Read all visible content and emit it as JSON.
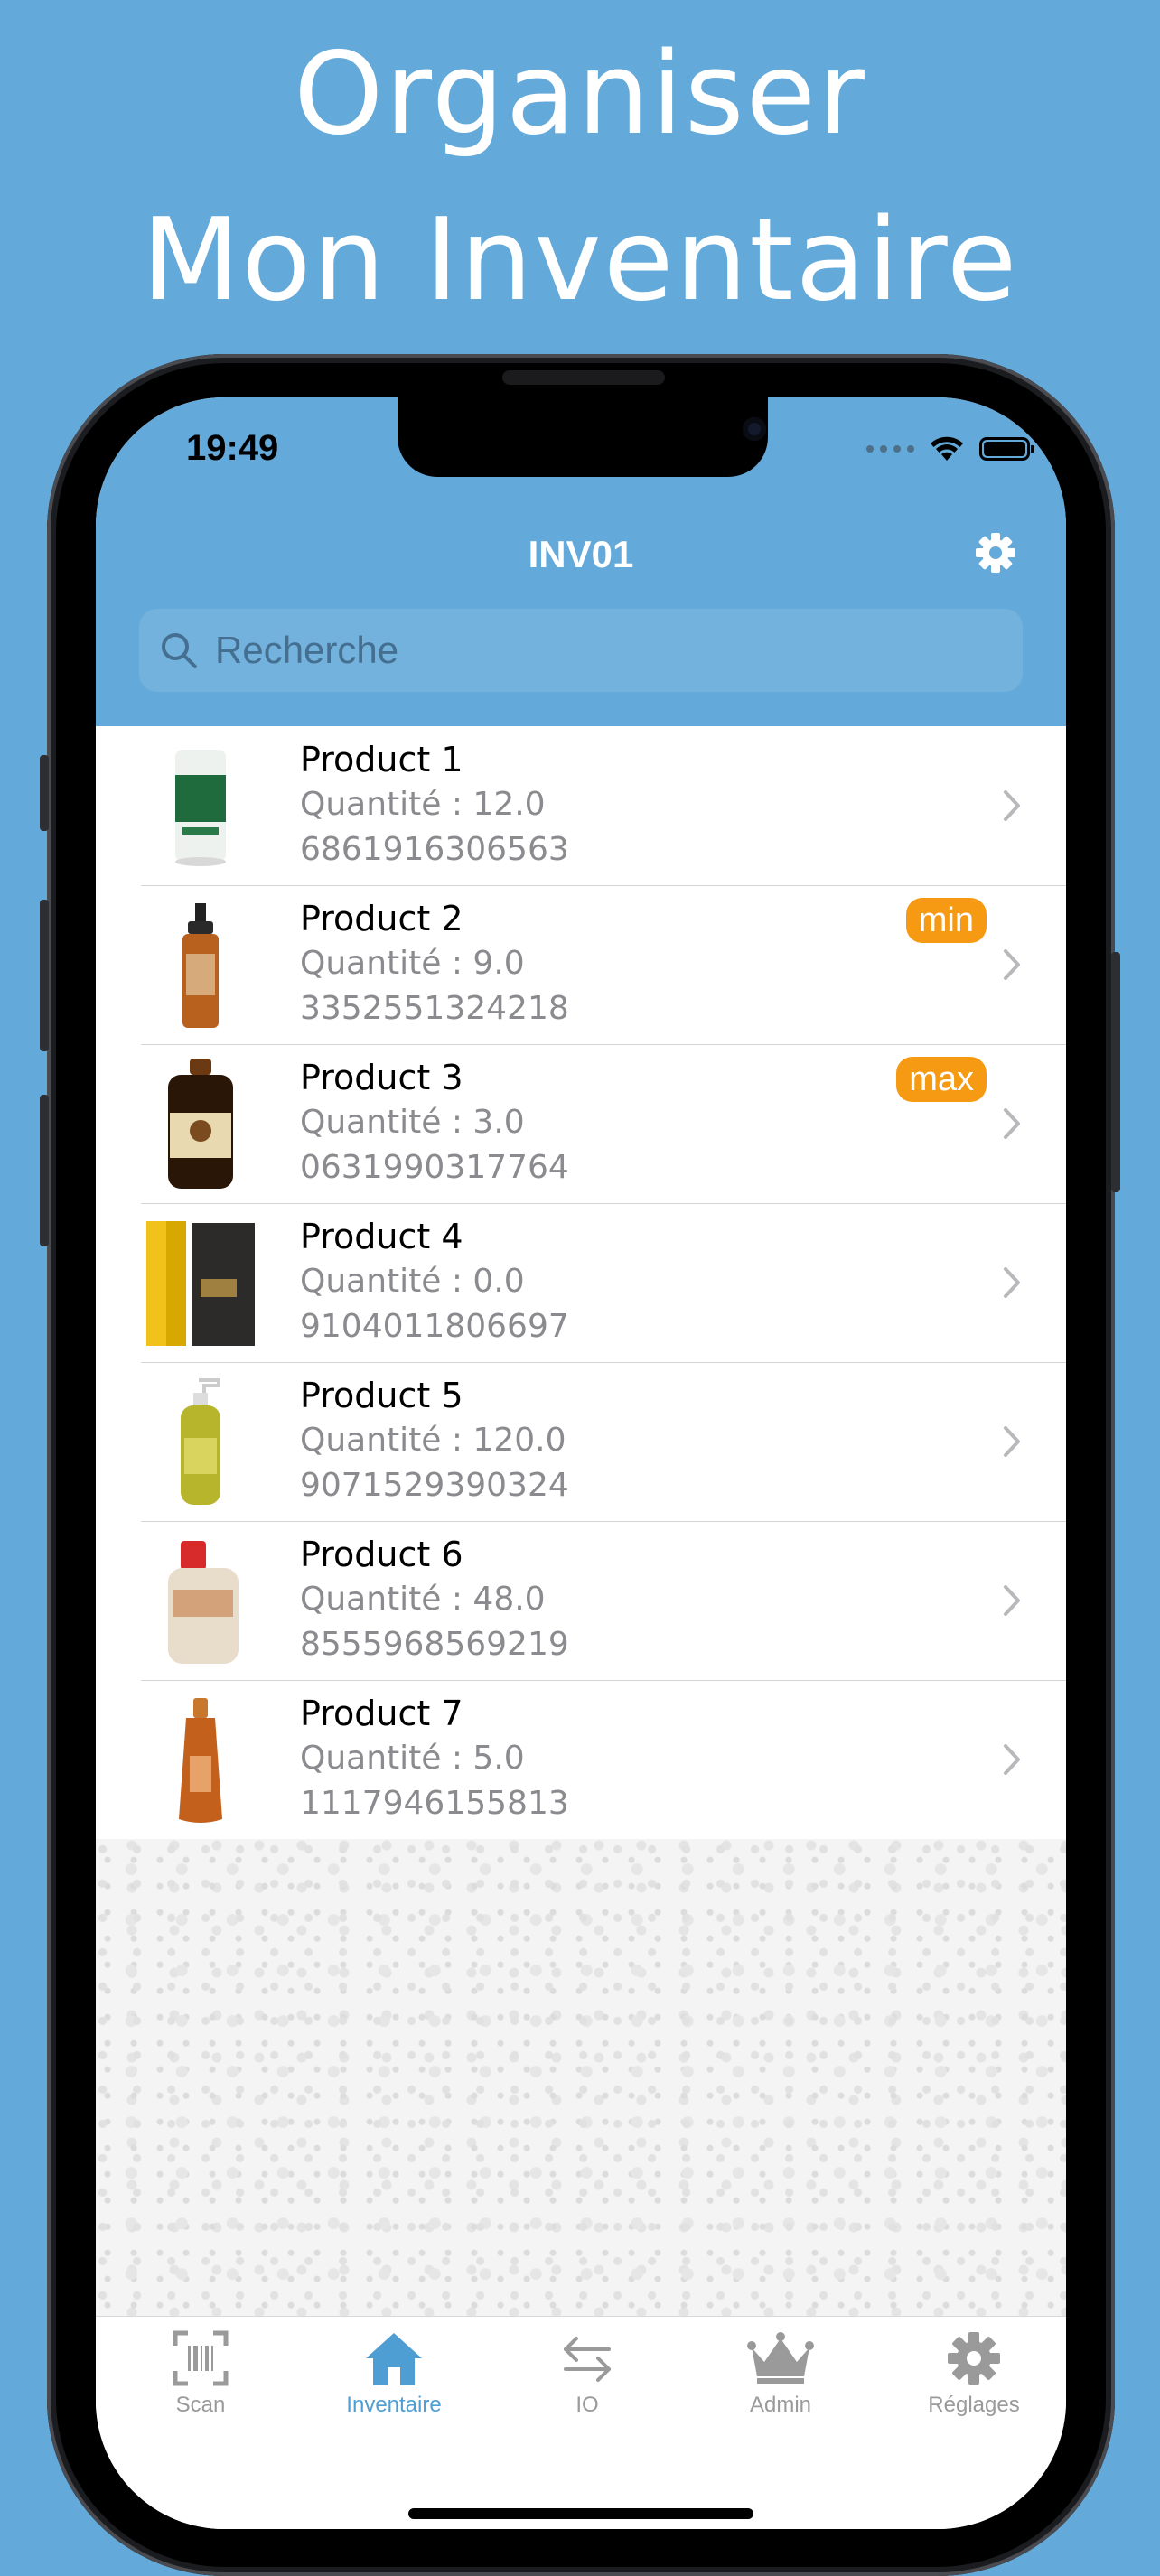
{
  "headline": [
    "Organiser",
    "Mon Inventaire"
  ],
  "status_bar": {
    "time": "19:49"
  },
  "nav": {
    "title": "INV01",
    "settings_icon": "gear-icon"
  },
  "search": {
    "placeholder": "Recherche",
    "value": ""
  },
  "products": [
    {
      "name": "Product 1",
      "quantity": "Quantité : 12.0",
      "barcode": "6861916306563",
      "badge": ""
    },
    {
      "name": "Product 2",
      "quantity": "Quantité : 9.0",
      "barcode": "3352551324218",
      "badge": "min"
    },
    {
      "name": "Product 3",
      "quantity": "Quantité : 3.0",
      "barcode": "0631990317764",
      "badge": "max"
    },
    {
      "name": "Product 4",
      "quantity": "Quantité : 0.0",
      "barcode": "9104011806697",
      "badge": ""
    },
    {
      "name": "Product 5",
      "quantity": "Quantité : 120.0",
      "barcode": "9071529390324",
      "badge": ""
    },
    {
      "name": "Product 6",
      "quantity": "Quantité : 48.0",
      "barcode": "8555968569219",
      "badge": ""
    },
    {
      "name": "Product 7",
      "quantity": "Quantité : 5.0",
      "barcode": "1117946155813",
      "badge": ""
    }
  ],
  "tabs": [
    {
      "label": "Scan",
      "icon": "barcode-scan-icon",
      "active": false
    },
    {
      "label": "Inventaire",
      "icon": "home-icon",
      "active": true
    },
    {
      "label": "IO",
      "icon": "arrows-exchange-icon",
      "active": false
    },
    {
      "label": "Admin",
      "icon": "crown-icon",
      "active": false
    },
    {
      "label": "Réglages",
      "icon": "gear-icon",
      "active": false
    }
  ],
  "colors": {
    "background": "#63a9d9",
    "accent": "#4f9ed3",
    "badge": "#f59a12"
  }
}
